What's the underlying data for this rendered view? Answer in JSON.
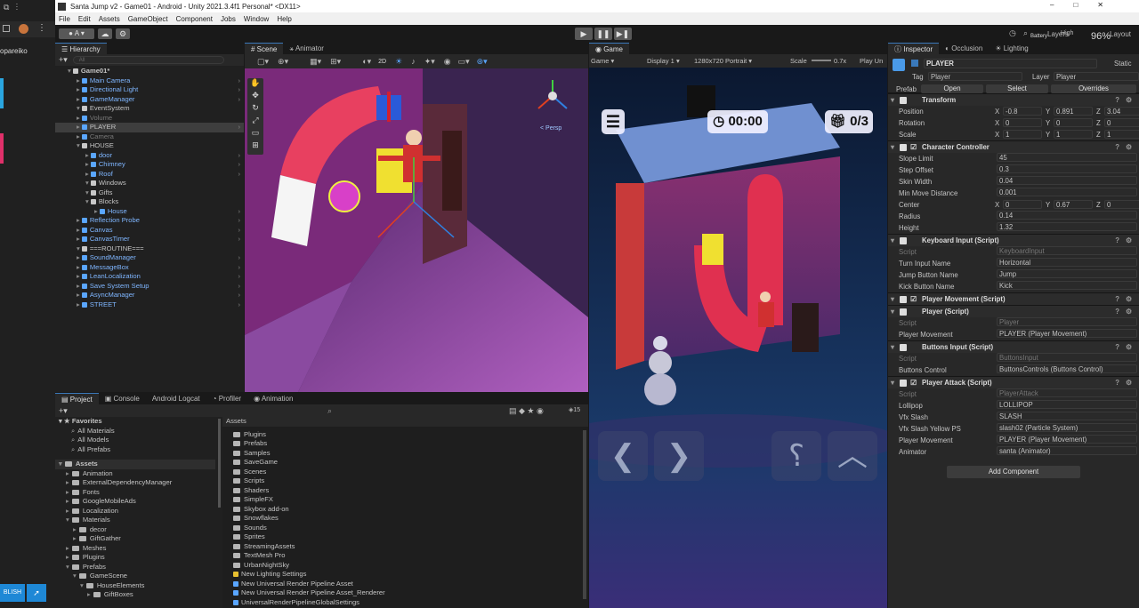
{
  "window": {
    "title": "Santa Jump v2 - Game01 - Android - Unity 2021.3.4f1 Personal* <DX11>",
    "controls": [
      "–",
      "□",
      "✕"
    ]
  },
  "menu": [
    "File",
    "Edit",
    "Assets",
    "GameObject",
    "Component",
    "Jobs",
    "Window",
    "Help"
  ],
  "left_strip": {
    "user": "opareiko",
    "publish_label": "BLISH"
  },
  "toolbar": {
    "account": "A"
  },
  "overlay": {
    "battery": "Battery",
    "percent": "96%",
    "layers": "Layers",
    "layout": "Layout",
    "quality": "High"
  },
  "hierarchy": {
    "tab": "Hierarchy",
    "search_placeholder": "All",
    "items": [
      {
        "label": "Game01*",
        "indent": 0,
        "style": "root"
      },
      {
        "label": "Main Camera",
        "indent": 1,
        "style": "blue"
      },
      {
        "label": "Directional Light",
        "indent": 1,
        "style": "blue"
      },
      {
        "label": "GameManager",
        "indent": 1,
        "style": "blue"
      },
      {
        "label": "EventSystem",
        "indent": 1,
        "style": "white"
      },
      {
        "label": "Volume",
        "indent": 1,
        "style": "dim"
      },
      {
        "label": "PLAYER",
        "indent": 1,
        "style": "selected"
      },
      {
        "label": "Camera",
        "indent": 1,
        "style": "dim"
      },
      {
        "label": "HOUSE",
        "indent": 1,
        "style": "white"
      },
      {
        "label": "door",
        "indent": 2,
        "style": "blue"
      },
      {
        "label": "Chimney",
        "indent": 2,
        "style": "blue"
      },
      {
        "label": "Roof",
        "indent": 2,
        "style": "blue"
      },
      {
        "label": "Windows",
        "indent": 2,
        "style": "white"
      },
      {
        "label": "Gifts",
        "indent": 2,
        "style": "white"
      },
      {
        "label": "Blocks",
        "indent": 2,
        "style": "white"
      },
      {
        "label": "House",
        "indent": 3,
        "style": "blue"
      },
      {
        "label": "Reflection Probe",
        "indent": 1,
        "style": "blue"
      },
      {
        "label": "Canvas",
        "indent": 1,
        "style": "blue"
      },
      {
        "label": "CanvasTimer",
        "indent": 1,
        "style": "blue"
      },
      {
        "label": "===ROUTINE===",
        "indent": 1,
        "style": "white"
      },
      {
        "label": "SoundManager",
        "indent": 1,
        "style": "blue"
      },
      {
        "label": "MessageBox",
        "indent": 1,
        "style": "blue"
      },
      {
        "label": "LeanLocalization",
        "indent": 1,
        "style": "blue"
      },
      {
        "label": "Save System Setup",
        "indent": 1,
        "style": "blue"
      },
      {
        "label": "AsyncManager",
        "indent": 1,
        "style": "blue"
      },
      {
        "label": "STREET",
        "indent": 1,
        "style": "blue"
      }
    ]
  },
  "scene": {
    "tabs": [
      "Scene",
      "Animator"
    ],
    "persp": "< Persp",
    "toggle_2d": "2D"
  },
  "game": {
    "tab": "Game",
    "mode": "Game",
    "display": "Display 1",
    "resolution": "1280x720 Portrait",
    "scale_label": "Scale",
    "scale_value": "0.7x",
    "play_label": "Play Un",
    "timer": "00:00",
    "gifts": "0/3"
  },
  "project": {
    "tabs": [
      "Project",
      "Console",
      "Android Logcat",
      "Profiler",
      "Animation"
    ],
    "count": "15",
    "favorites_label": "Favorites",
    "favorites": [
      "All Materials",
      "All Models",
      "All Prefabs"
    ],
    "tree": [
      {
        "label": "Assets",
        "indent": 0
      },
      {
        "label": "Animation",
        "indent": 1
      },
      {
        "label": "ExternalDependencyManager",
        "indent": 1
      },
      {
        "label": "Fonts",
        "indent": 1
      },
      {
        "label": "GoogleMobileAds",
        "indent": 1
      },
      {
        "label": "Localization",
        "indent": 1
      },
      {
        "label": "Materials",
        "indent": 1
      },
      {
        "label": "decor",
        "indent": 2
      },
      {
        "label": "GiftGather",
        "indent": 2
      },
      {
        "label": "Meshes",
        "indent": 1
      },
      {
        "label": "Plugins",
        "indent": 1
      },
      {
        "label": "Prefabs",
        "indent": 1
      },
      {
        "label": "GameScene",
        "indent": 2
      },
      {
        "label": "HouseElements",
        "indent": 3
      },
      {
        "label": "GiftBoxes",
        "indent": 4
      }
    ],
    "breadcrumb": "Assets",
    "files": [
      "Plugins",
      "Prefabs",
      "Samples",
      "SaveGame",
      "Scenes",
      "Scripts",
      "Shaders",
      "SimpleFX",
      "Skybox add-on",
      "Snowflakes",
      "Sounds",
      "Sprites",
      "StreamingAssets",
      "TextMesh Pro",
      "UrbanNightSky",
      "New Lighting Settings",
      "New Universal Render Pipeline Asset",
      "New Universal Render Pipeline Asset_Renderer",
      "UniversalRenderPipelineGlobalSettings"
    ]
  },
  "inspector": {
    "tabs": [
      "Inspector",
      "Occlusion",
      "Lighting"
    ],
    "object_name": "PLAYER",
    "static_label": "Static",
    "tag_label": "Tag",
    "tag_value": "Player",
    "layer_label": "Layer",
    "layer_value": "Player",
    "prefab_label": "Prefab",
    "open_label": "Open",
    "select_label": "Select",
    "overrides_label": "Overrides",
    "transform": {
      "title": "Transform",
      "position": {
        "label": "Position",
        "x": "-0.8",
        "y": "0.891",
        "z": "3.04"
      },
      "rotation": {
        "label": "Rotation",
        "x": "0",
        "y": "0",
        "z": "0"
      },
      "scale": {
        "label": "Scale",
        "x": "1",
        "y": "1",
        "z": "1"
      }
    },
    "character_controller": {
      "title": "Character Controller",
      "fields": [
        {
          "label": "Slope Limit",
          "value": "45"
        },
        {
          "label": "Step Offset",
          "value": "0.3"
        },
        {
          "label": "Skin Width",
          "value": "0.04"
        },
        {
          "label": "Min Move Distance",
          "value": "0.001"
        }
      ],
      "center": {
        "label": "Center",
        "x": "0",
        "y": "0.67",
        "z": "0"
      },
      "fields2": [
        {
          "label": "Radius",
          "value": "0.14"
        },
        {
          "label": "Height",
          "value": "1.32"
        }
      ]
    },
    "keyboard_input": {
      "title": "Keyboard Input (Script)",
      "fields": [
        {
          "label": "Script",
          "value": "KeyboardInput"
        },
        {
          "label": "Turn Input Name",
          "value": "Horizontal"
        },
        {
          "label": "Jump Button Name",
          "value": "Jump"
        },
        {
          "label": "Kick Button Name",
          "value": "Kick"
        }
      ]
    },
    "player_movement": {
      "title": "Player Movement (Script)"
    },
    "player": {
      "title": "Player (Script)",
      "fields": [
        {
          "label": "Script",
          "value": "Player"
        },
        {
          "label": "Player Movement",
          "value": "PLAYER (Player Movement)"
        }
      ]
    },
    "buttons_input": {
      "title": "Buttons Input (Script)",
      "fields": [
        {
          "label": "Script",
          "value": "ButtonsInput"
        },
        {
          "label": "Buttons Control",
          "value": "ButtonsControls (Buttons Control)"
        }
      ]
    },
    "player_attack": {
      "title": "Player Attack (Script)",
      "fields": [
        {
          "label": "Script",
          "value": "PlayerAttack"
        },
        {
          "label": "Lollipop",
          "value": "LOLLIPOP"
        },
        {
          "label": "Vfx Slash",
          "value": "SLASH"
        },
        {
          "label": "Vfx Slash Yellow PS",
          "value": "slash02 (Particle System)"
        },
        {
          "label": "Player Movement",
          "value": "PLAYER (Player Movement)"
        },
        {
          "label": "Animator",
          "value": "santa (Animator)"
        }
      ]
    },
    "add_component": "Add Component"
  }
}
